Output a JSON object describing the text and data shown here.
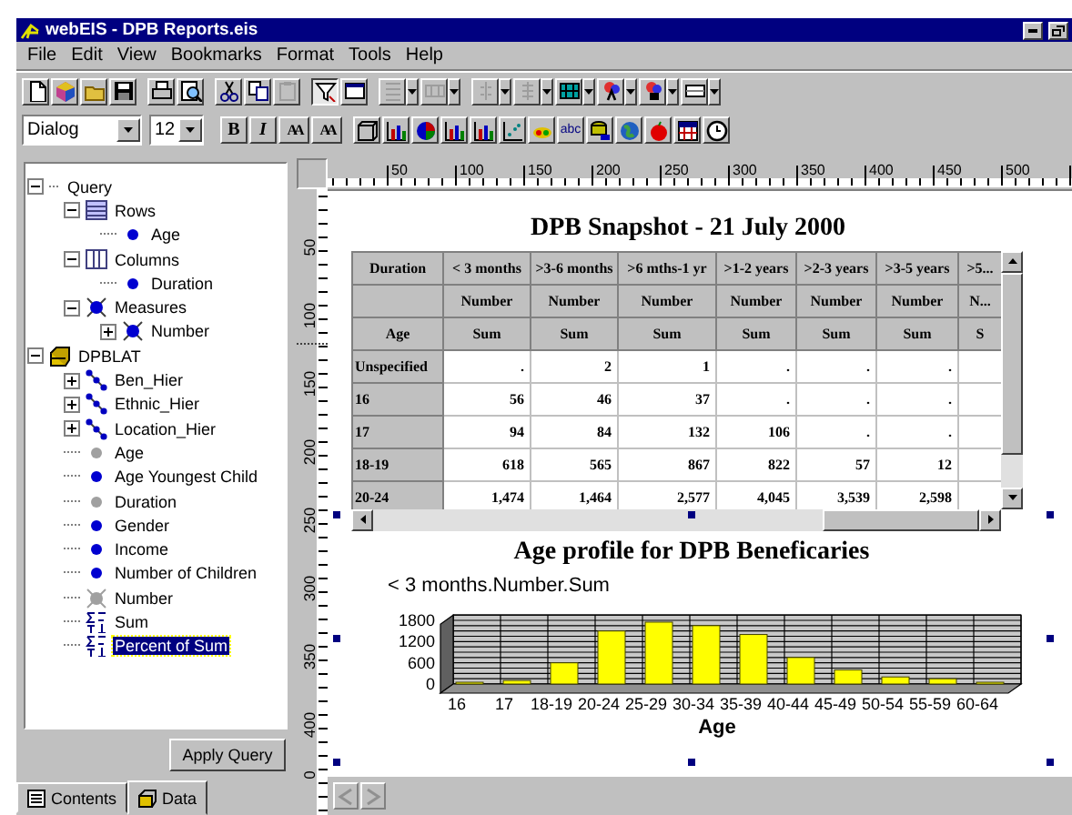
{
  "window": {
    "title": "webEIS - DPB Reports.eis"
  },
  "menu": [
    "File",
    "Edit",
    "View",
    "Bookmarks",
    "Format",
    "Tools",
    "Help"
  ],
  "toolbar_1": [
    {
      "kind": "new",
      "disabled": false,
      "pressed": false,
      "menu": false
    },
    {
      "kind": "cube",
      "disabled": false,
      "pressed": false,
      "menu": false
    },
    {
      "kind": "open",
      "disabled": false,
      "pressed": false,
      "menu": false
    },
    {
      "kind": "save",
      "disabled": false,
      "pressed": false,
      "menu": false
    },
    {
      "kind": "separator"
    },
    {
      "kind": "print",
      "disabled": false,
      "pressed": false,
      "menu": false
    },
    {
      "kind": "preview",
      "disabled": false,
      "pressed": false,
      "menu": false
    },
    {
      "kind": "separator"
    },
    {
      "kind": "cut",
      "disabled": false,
      "pressed": false,
      "menu": false
    },
    {
      "kind": "copy",
      "disabled": false,
      "pressed": false,
      "menu": false
    },
    {
      "kind": "paste",
      "disabled": true,
      "pressed": false,
      "menu": false
    },
    {
      "kind": "separator"
    },
    {
      "kind": "filter",
      "disabled": false,
      "pressed": true,
      "menu": false
    },
    {
      "kind": "window",
      "disabled": false,
      "pressed": false,
      "menu": false
    },
    {
      "kind": "separator"
    },
    {
      "kind": "rows",
      "disabled": true,
      "pressed": false,
      "menu": true
    },
    {
      "kind": "columns",
      "disabled": true,
      "pressed": false,
      "menu": true
    },
    {
      "kind": "separator"
    },
    {
      "kind": "swap",
      "disabled": true,
      "pressed": false,
      "menu": true
    },
    {
      "kind": "sort",
      "disabled": true,
      "pressed": false,
      "menu": true
    },
    {
      "kind": "split",
      "disabled": false,
      "pressed": false,
      "menu": true
    },
    {
      "kind": "color-text",
      "disabled": false,
      "pressed": false,
      "menu": true
    },
    {
      "kind": "color-fill",
      "disabled": false,
      "pressed": false,
      "menu": true
    },
    {
      "kind": "frame",
      "disabled": false,
      "pressed": false,
      "menu": true
    }
  ],
  "toolbar_2": {
    "font": "Dialog",
    "size": "12",
    "items": [
      {
        "kind": "bold",
        "label": "B"
      },
      {
        "kind": "italic",
        "label": "I"
      },
      {
        "kind": "font-up",
        "label": "AA"
      },
      {
        "kind": "font-down",
        "label": "AA"
      },
      {
        "kind": "separator"
      },
      {
        "kind": "box"
      },
      {
        "kind": "bar-chart"
      },
      {
        "kind": "pie-chart"
      },
      {
        "kind": "bar-chart"
      },
      {
        "kind": "bar-chart"
      },
      {
        "kind": "scatter-chart"
      },
      {
        "kind": "paint"
      },
      {
        "kind": "text",
        "label": "abc"
      },
      {
        "kind": "database"
      },
      {
        "kind": "globe"
      },
      {
        "kind": "apple"
      },
      {
        "kind": "calendar"
      },
      {
        "kind": "clock"
      }
    ]
  },
  "tree": [
    {
      "label": "Query",
      "kind": "root",
      "expanded": true,
      "selected": false,
      "children": [
        {
          "label": "Rows",
          "kind": "rows",
          "expanded": true,
          "selected": false,
          "children": [
            {
              "label": "Age",
              "kind": "dimension",
              "disabled": false,
              "selected": false
            }
          ]
        },
        {
          "label": "Columns",
          "kind": "columns",
          "expanded": true,
          "selected": false,
          "children": [
            {
              "label": "Duration",
              "kind": "dimension",
              "disabled": false,
              "selected": false
            }
          ]
        },
        {
          "label": "Measures",
          "kind": "measure",
          "disabled": false,
          "expanded": true,
          "selected": false,
          "children": [
            {
              "label": "Number",
              "kind": "measure",
              "disabled": false,
              "expanded": false,
              "selected": false
            }
          ]
        }
      ]
    },
    {
      "label": "DPBLAT",
      "kind": "cube",
      "expanded": true,
      "selected": false,
      "children": [
        {
          "label": "Ben_Hier",
          "kind": "hierarchy",
          "expanded": false,
          "selected": false
        },
        {
          "label": "Ethnic_Hier",
          "kind": "hierarchy",
          "expanded": false,
          "selected": false
        },
        {
          "label": "Location_Hier",
          "kind": "hierarchy",
          "expanded": false,
          "selected": false
        },
        {
          "label": "Age",
          "kind": "dimension",
          "disabled": true,
          "selected": false
        },
        {
          "label": "Age Youngest Child",
          "kind": "dimension",
          "disabled": false,
          "selected": false
        },
        {
          "label": "Duration",
          "kind": "dimension",
          "disabled": true,
          "selected": false
        },
        {
          "label": "Gender",
          "kind": "dimension",
          "disabled": false,
          "selected": false
        },
        {
          "label": "Income",
          "kind": "dimension",
          "disabled": false,
          "selected": false
        },
        {
          "label": "Number of Children",
          "kind": "dimension",
          "disabled": false,
          "selected": false
        },
        {
          "label": "Number",
          "kind": "measure",
          "disabled": true,
          "selected": false
        },
        {
          "label": "Sum",
          "kind": "statistic",
          "selected": false
        },
        {
          "label": "Percent of Sum",
          "kind": "statistic",
          "selected": true
        }
      ]
    }
  ],
  "apply_button": "Apply Query",
  "panel_tabs": [
    {
      "label": "Contents",
      "kind": "contents",
      "selected": false
    },
    {
      "label": "Data",
      "kind": "data",
      "selected": true
    }
  ],
  "ruler": {
    "horizontal_labels": [
      "50",
      "100",
      "150",
      "200",
      "250",
      "300",
      "350",
      "400",
      "450",
      "500"
    ],
    "vertical_labels": [
      "50",
      "100",
      "150",
      "200",
      "250",
      "300",
      "350",
      "400",
      "0"
    ]
  },
  "report": {
    "title": "DPB Snapshot - 21 July 2000",
    "table": {
      "corner": "Duration",
      "row_header": "Age",
      "columns": [
        {
          "duration": "< 3 months",
          "measure": "Number",
          "statistic": "Sum"
        },
        {
          "duration": ">3-6 months",
          "measure": "Number",
          "statistic": "Sum"
        },
        {
          "duration": ">6 mths-1 yr",
          "measure": "Number",
          "statistic": "Sum"
        },
        {
          "duration": ">1-2 years",
          "measure": "Number",
          "statistic": "Sum"
        },
        {
          "duration": ">2-3 years",
          "measure": "Number",
          "statistic": "Sum"
        },
        {
          "duration": ">3-5 years",
          "measure": "Number",
          "statistic": "Sum"
        },
        {
          "duration": ">5...",
          "measure": "N...",
          "statistic": "S"
        }
      ],
      "rows": [
        {
          "label": "Unspecified",
          "values": [
            ".",
            "2",
            "1",
            ".",
            ".",
            "."
          ]
        },
        {
          "label": "16",
          "values": [
            "56",
            "46",
            "37",
            ".",
            ".",
            "."
          ]
        },
        {
          "label": "17",
          "values": [
            "94",
            "84",
            "132",
            "106",
            ".",
            "."
          ]
        },
        {
          "label": "18-19",
          "values": [
            "618",
            "565",
            "867",
            "822",
            "57",
            "12"
          ]
        },
        {
          "label": "20-24",
          "values": [
            "1,474",
            "1,464",
            "2,577",
            "4,045",
            "3,539",
            "2,598"
          ]
        }
      ]
    },
    "chart_data": {
      "type": "bar",
      "title": "Age profile for DPB Beneficaries",
      "ylabel": "< 3 months.Number.Sum",
      "xlabel": "Age",
      "categories": [
        "16",
        "17",
        "18-19",
        "20-24",
        "25-29",
        "30-34",
        "35-39",
        "40-44",
        "45-49",
        "50-54",
        "55-59",
        "60-64"
      ],
      "series": [
        {
          "color": "#ffff00",
          "values": [
            50,
            100,
            600,
            1500,
            1750,
            1650,
            1400,
            750,
            400,
            200,
            150,
            50
          ]
        }
      ],
      "ylim": [
        0,
        1800
      ],
      "yticks": [
        0,
        600,
        1200,
        1800
      ],
      "grid": true
    }
  }
}
